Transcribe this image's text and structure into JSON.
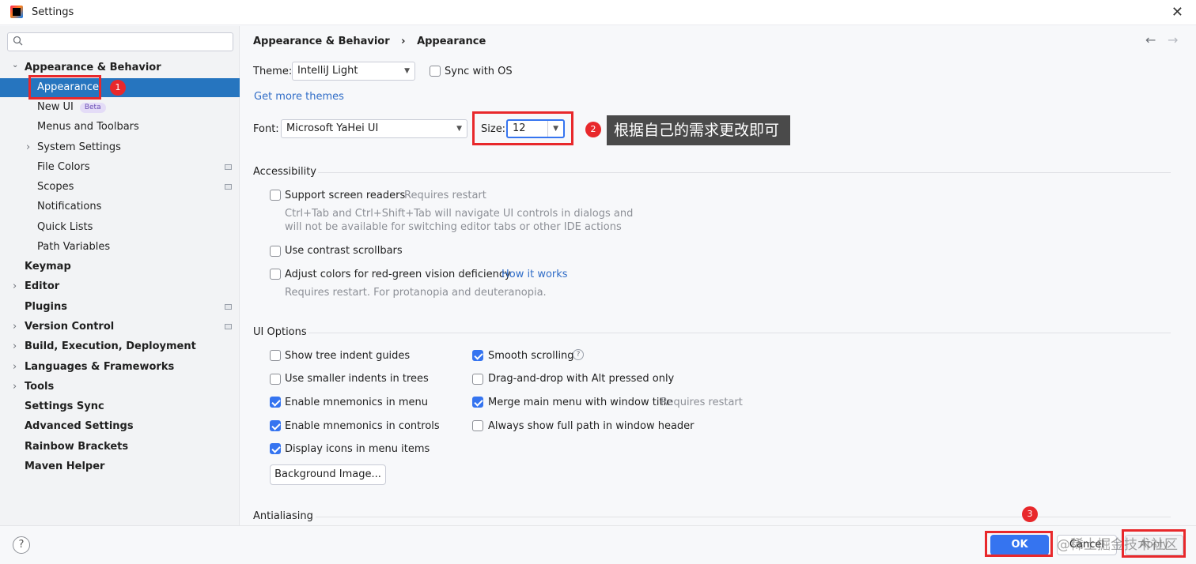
{
  "window": {
    "title": "Settings",
    "close": "✕"
  },
  "search": {
    "placeholder": ""
  },
  "sidebar": {
    "items": [
      {
        "label": "Appearance & Behavior",
        "chevron": "⌄"
      },
      {
        "label": "Appearance"
      },
      {
        "label": "New UI",
        "badge": "Beta"
      },
      {
        "label": "Menus and Toolbars"
      },
      {
        "label": "System Settings",
        "chevron": "›"
      },
      {
        "label": "File Colors"
      },
      {
        "label": "Scopes"
      },
      {
        "label": "Notifications"
      },
      {
        "label": "Quick Lists"
      },
      {
        "label": "Path Variables"
      },
      {
        "label": "Keymap"
      },
      {
        "label": "Editor",
        "chevron": "›"
      },
      {
        "label": "Plugins"
      },
      {
        "label": "Version Control",
        "chevron": "›"
      },
      {
        "label": "Build, Execution, Deployment",
        "chevron": "›"
      },
      {
        "label": "Languages & Frameworks",
        "chevron": "›"
      },
      {
        "label": "Tools",
        "chevron": "›"
      },
      {
        "label": "Settings Sync"
      },
      {
        "label": "Advanced Settings"
      },
      {
        "label": "Rainbow Brackets"
      },
      {
        "label": "Maven Helper"
      }
    ]
  },
  "breadcrumb": {
    "parent": "Appearance & Behavior",
    "sep": "›",
    "current": "Appearance",
    "back": "←",
    "forward": "→"
  },
  "appearance": {
    "theme_label": "Theme:",
    "theme_value": "IntelliJ Light",
    "sync_os": "Sync with OS",
    "get_more_themes": "Get more themes",
    "font_label": "Font:",
    "font_value": "Microsoft YaHei UI",
    "size_label": "Size:",
    "size_value": "12"
  },
  "accessibility": {
    "title": "Accessibility",
    "screen_readers": "Support screen readers",
    "screen_readers_note": "Requires restart",
    "screen_readers_desc1": "Ctrl+Tab and Ctrl+Shift+Tab will navigate UI controls in dialogs and",
    "screen_readers_desc2": "will not be available for switching editor tabs or other IDE actions",
    "contrast_scrollbars": "Use contrast scrollbars",
    "adjust_colors": "Adjust colors for red-green vision deficiency",
    "how_it_works": "How it works",
    "adjust_colors_note": "Requires restart. For protanopia and deuteranopia."
  },
  "ui_options": {
    "title": "UI Options",
    "tree_indent": "Show tree indent guides",
    "smaller_indents": "Use smaller indents in trees",
    "mnemonics_menu": "Enable mnemonics in menu",
    "mnemonics_controls": "Enable mnemonics in controls",
    "icons_menu": "Display icons in menu items",
    "background_image": "Background Image...",
    "smooth_scrolling": "Smooth scrolling",
    "help_q": "?",
    "drag_drop_alt": "Drag-and-drop with Alt pressed only",
    "merge_menu": "Merge main menu with window title",
    "merge_menu_note": "Requires restart",
    "full_path": "Always show full path in window header"
  },
  "antialiasing": {
    "title": "Antialiasing"
  },
  "annotations": {
    "n1": "1",
    "n2": "2",
    "n3": "3",
    "tooltip": "根据自己的需求更改即可",
    "watermark": "@稀土掘金技术社区"
  },
  "footer": {
    "help": "?",
    "ok": "OK",
    "cancel": "Cancel",
    "apply": "Apply"
  },
  "colors": {
    "selection": "#2675bf",
    "accent": "#3574f0",
    "annotation_red": "#e8282b"
  }
}
